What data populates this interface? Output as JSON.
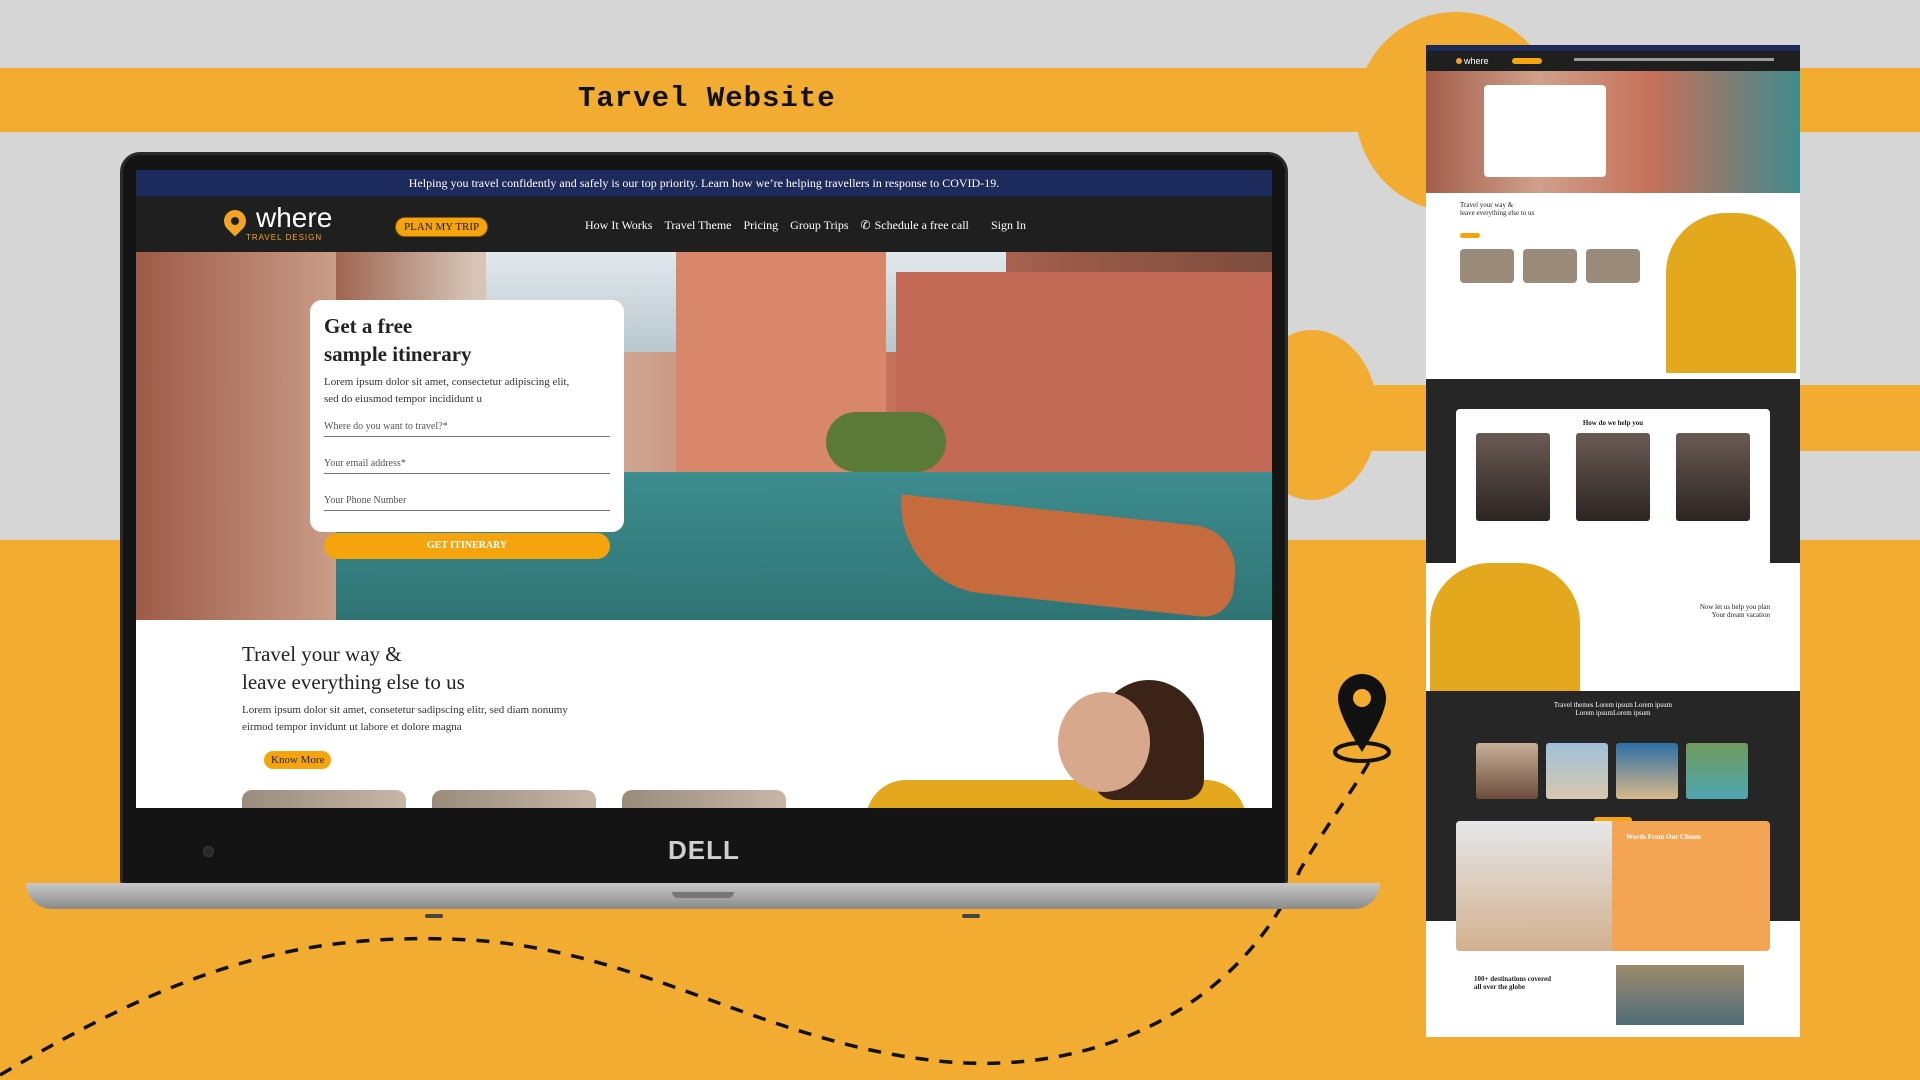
{
  "page_title": "Tarvel Website",
  "laptop": {
    "brand": "DELL"
  },
  "site": {
    "covid_banner": "Helping you travel confidently and safely is our top priority. Learn how we’re helping travellers in response to COVID-19.",
    "logo": {
      "name": "where",
      "subtitle": "TRAVEL DESIGN"
    },
    "plan_button": "PLAN MY TRIP",
    "menu": [
      "How It Works",
      "Travel Theme",
      "Pricing",
      "Group Trips"
    ],
    "schedule_call": "Schedule a free call",
    "sign_in": "Sign In",
    "hero_form": {
      "title_line1": "Get a free",
      "title_line2": "sample itinerary",
      "desc_line1": "Lorem ipsum dolor sit amet, consectetur adipiscing elit,",
      "desc_line2": "sed do eiusmod tempor incididunt u",
      "fields": [
        {
          "placeholder": "Where do you want to travel?*"
        },
        {
          "placeholder": "Your email address*"
        },
        {
          "placeholder": "Your Phone Number"
        }
      ],
      "button": "GET ITINERARY"
    },
    "section_travel": {
      "title_line1": "Travel your way &",
      "title_line2": "leave everything else to us",
      "desc_line1": "Lorem ipsum dolor sit amet, consetetur sadipscing elitr, sed diam nonumy",
      "desc_line2": "eirmod tempor invidunt ut labore et dolore magna",
      "button": "Know More"
    }
  },
  "preview": {
    "section_travel_title": "Travel your way &",
    "section_travel_title2": "leave everything else to us",
    "help_title": "How do we help you",
    "plan_title_line1": "Now let us help you plan",
    "plan_title_line2": "Your dream vacation",
    "themes_title_line1": "Travel themes Lorem ipsum Lorem ipsum",
    "themes_title_line2": "Lorem ipsumLorem ipsum",
    "testimonial_title": "Words From Our Clients",
    "destinations_line1": "100+ destinations covered",
    "destinations_line2": "all over the globe"
  },
  "colors": {
    "accent": "#F6A40E",
    "background": "#F2AC32",
    "banner": "#1D2A5C",
    "nav": "#1F1F1F"
  },
  "icons": [
    "map-pin-icon",
    "phone-icon",
    "location-marker-icon"
  ]
}
